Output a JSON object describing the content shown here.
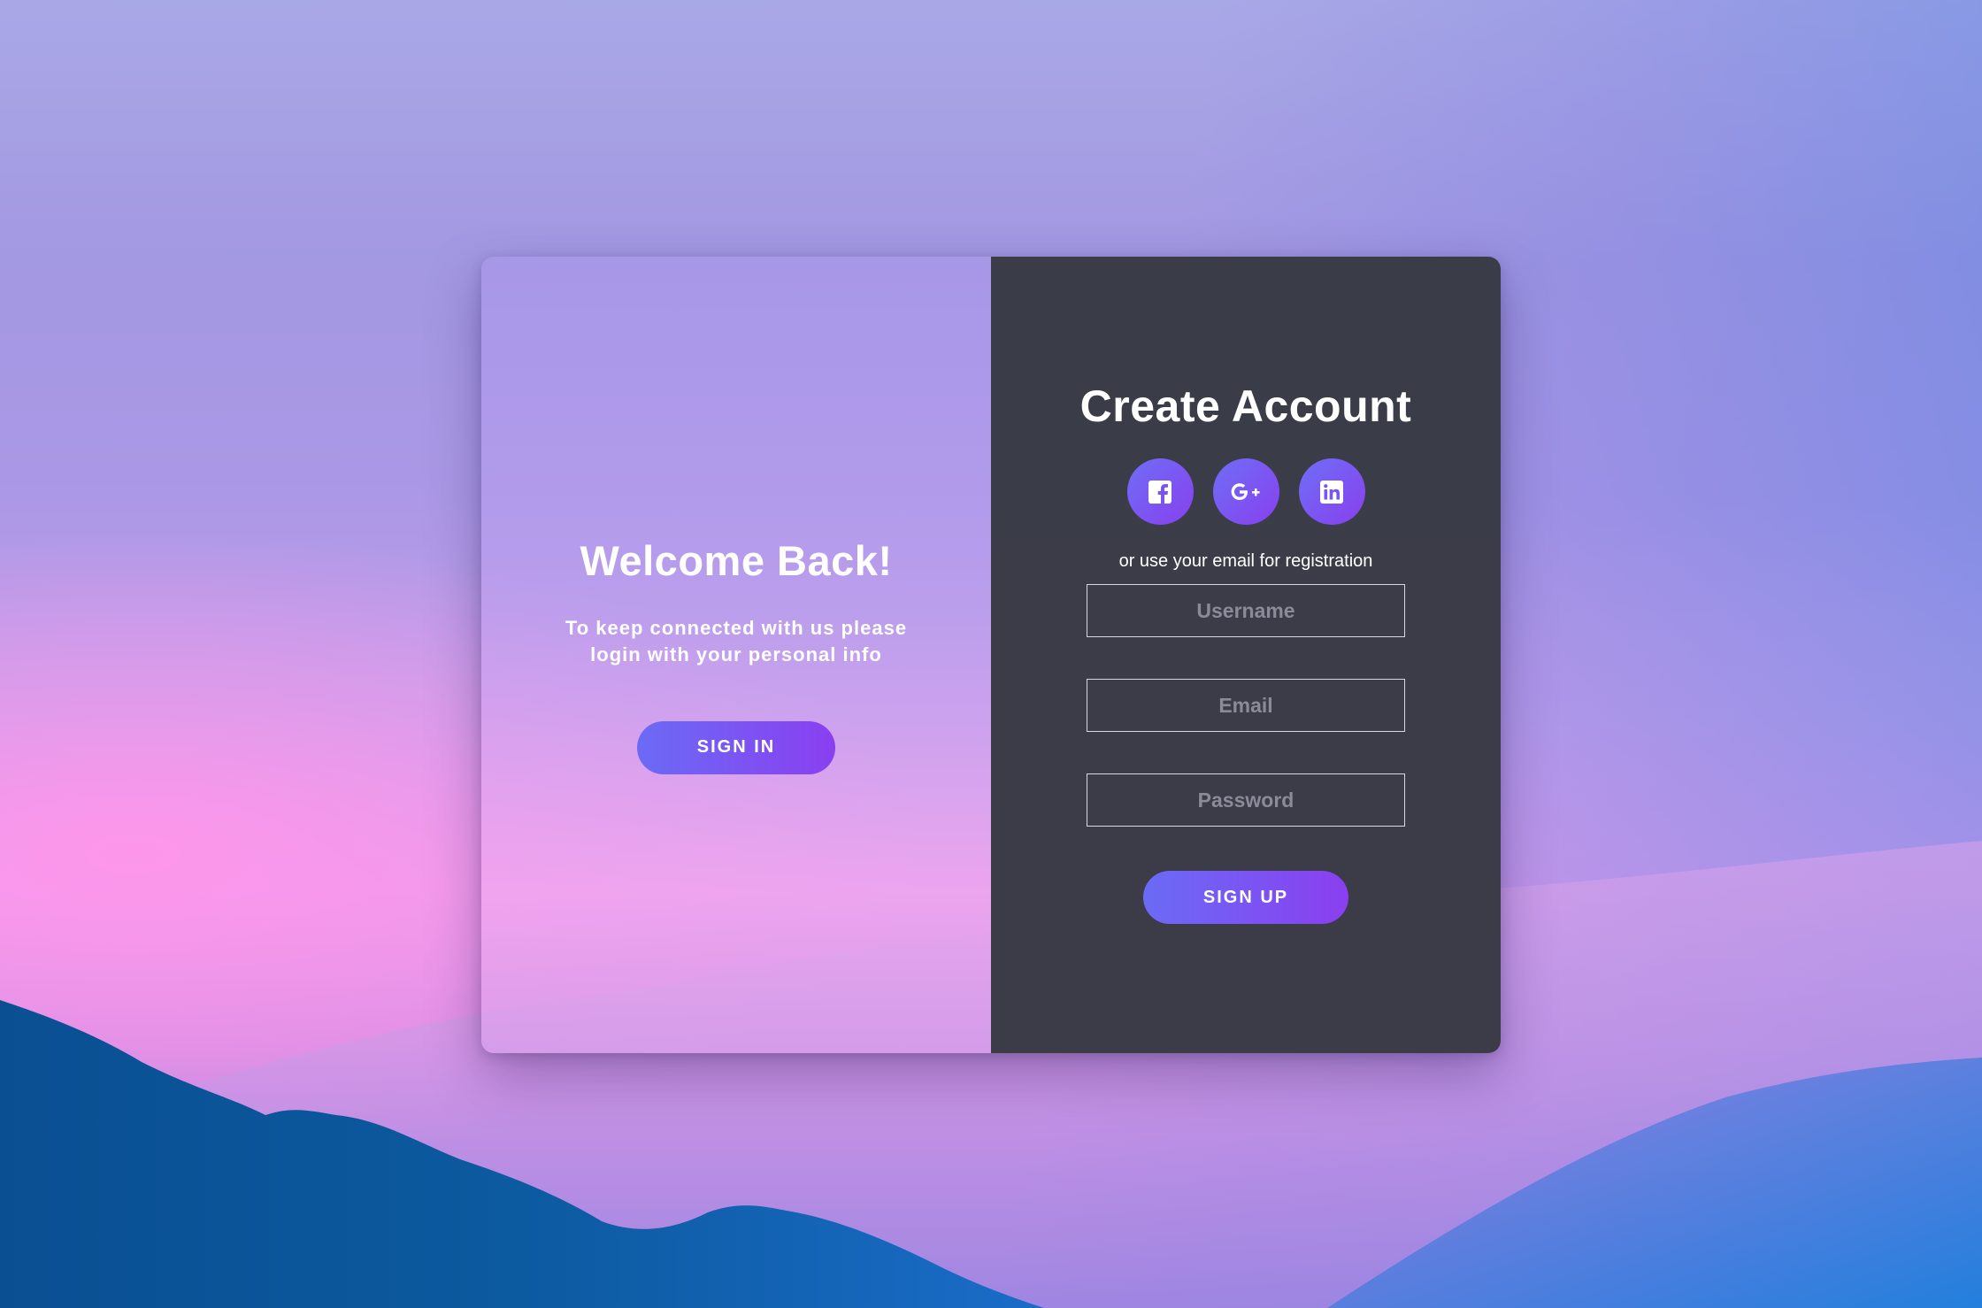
{
  "left_panel": {
    "title": "Welcome Back!",
    "subtitle": "To keep connected with us please login with your personal info",
    "signin_label": "SIGN IN"
  },
  "right_panel": {
    "title": "Create Account",
    "social_buttons": [
      {
        "icon": "facebook-icon",
        "glyph": "f"
      },
      {
        "icon": "google-plus-icon",
        "glyph": "G+"
      },
      {
        "icon": "linkedin-icon",
        "glyph": "in"
      }
    ],
    "hint": "or use your email for registration",
    "fields": {
      "username_placeholder": "Username",
      "email_placeholder": "Email",
      "password_placeholder": "Password"
    },
    "signup_label": "SIGN UP"
  },
  "colors": {
    "accent_start": "#6b6bf5",
    "accent_end": "#8a3ff0",
    "form_panel": "#3a3d48",
    "text": "#ffffff"
  }
}
